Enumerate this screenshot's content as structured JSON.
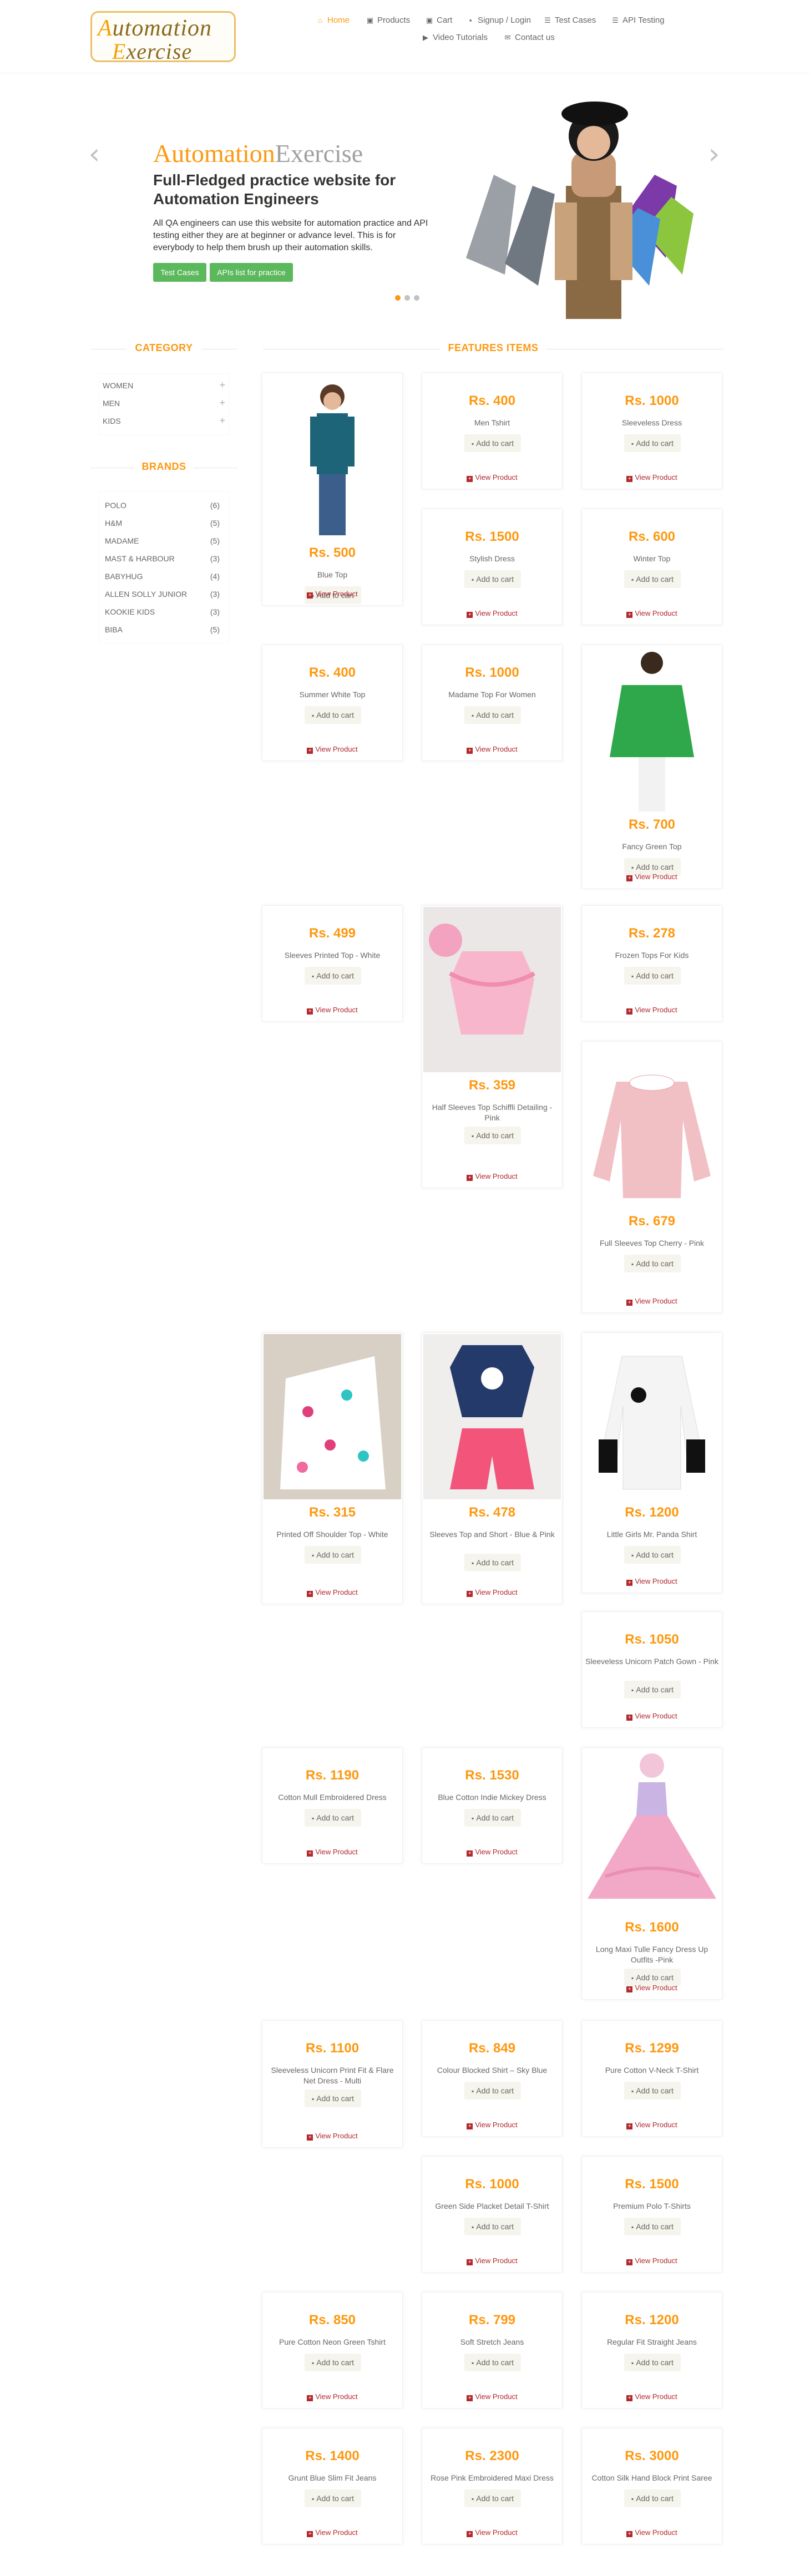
{
  "logo": {
    "line1": "Automation",
    "line2": "Exercise"
  },
  "nav": [
    {
      "label": "Home",
      "icon": "home-icon",
      "glyph": "⌂"
    },
    {
      "label": "Products",
      "icon": "products-icon",
      "glyph": "▣"
    },
    {
      "label": "Cart",
      "icon": "cart-icon",
      "glyph": "🛒"
    },
    {
      "label": "Signup / Login",
      "icon": "lock-icon",
      "glyph": "🔒"
    },
    {
      "label": "Test Cases",
      "icon": "list-icon",
      "glyph": "☰"
    },
    {
      "label": "API Testing",
      "icon": "list-icon",
      "glyph": "☰"
    },
    {
      "label": "Video Tutorials",
      "icon": "youtube-icon",
      "glyph": "▶"
    },
    {
      "label": "Contact us",
      "icon": "envelope-icon",
      "glyph": "✉"
    }
  ],
  "slider": {
    "title_a": "Automation",
    "title_b": "Exercise",
    "subtitle": "Full-Fledged practice website for Automation Engineers",
    "description": "All QA engineers can use this website for automation practice and API testing either they are at beginner or advance level. This is for everybody to help them brush up their automation skills.",
    "btn_test_cases": "Test Cases",
    "btn_apis": "APIs list for practice",
    "prev": "‹",
    "next": "›"
  },
  "category": {
    "title": "CATEGORY",
    "items": [
      {
        "label": "WOMEN",
        "plus": "+"
      },
      {
        "label": "MEN",
        "plus": "+"
      },
      {
        "label": "KIDS",
        "plus": "+"
      }
    ]
  },
  "brands": {
    "title": "BRANDS",
    "items": [
      {
        "label": "POLO",
        "count": "(6)"
      },
      {
        "label": "H&M",
        "count": "(5)"
      },
      {
        "label": "MADAME",
        "count": "(5)"
      },
      {
        "label": "MAST & HARBOUR",
        "count": "(3)"
      },
      {
        "label": "BABYHUG",
        "count": "(4)"
      },
      {
        "label": "ALLEN SOLLY JUNIOR",
        "count": "(3)"
      },
      {
        "label": "KOOKIE KIDS",
        "count": "(3)"
      },
      {
        "label": "BIBA",
        "count": "(5)"
      }
    ]
  },
  "features_title": "FEATURES ITEMS",
  "add_to_cart": "Add to cart",
  "view_product": "View Product",
  "products": [
    {
      "price": "Rs. 500",
      "name": "Blue Top"
    },
    {
      "price": "Rs. 400",
      "name": "Men Tshirt"
    },
    {
      "price": "Rs. 1000",
      "name": "Sleeveless Dress"
    },
    {
      "price": "Rs. 1500",
      "name": "Stylish Dress"
    },
    {
      "price": "Rs. 600",
      "name": "Winter Top"
    },
    {
      "price": "Rs. 400",
      "name": "Summer White Top"
    },
    {
      "price": "Rs. 1000",
      "name": "Madame Top For Women"
    },
    {
      "price": "Rs. 700",
      "name": "Fancy Green Top"
    },
    {
      "price": "Rs. 499",
      "name": "Sleeves Printed Top - White"
    },
    {
      "price": "Rs. 359",
      "name": "Half Sleeves Top Schiffli Detailing - Pink"
    },
    {
      "price": "Rs. 278",
      "name": "Frozen Tops For Kids"
    },
    {
      "price": "Rs. 679",
      "name": "Full Sleeves Top Cherry - Pink"
    },
    {
      "price": "Rs. 315",
      "name": "Printed Off Shoulder Top - White"
    },
    {
      "price": "Rs. 478",
      "name": "Sleeves Top and Short - Blue & Pink"
    },
    {
      "price": "Rs. 1200",
      "name": "Little Girls Mr. Panda Shirt"
    },
    {
      "price": "Rs. 1050",
      "name": "Sleeveless Unicorn Patch Gown - Pink"
    },
    {
      "price": "Rs. 1190",
      "name": "Cotton Mull Embroidered Dress"
    },
    {
      "price": "Rs. 1530",
      "name": "Blue Cotton Indie Mickey Dress"
    },
    {
      "price": "Rs. 1600",
      "name": "Long Maxi Tulle Fancy Dress Up Outfits -Pink"
    },
    {
      "price": "Rs. 1100",
      "name": "Sleeveless Unicorn Print Fit & Flare Net Dress - Multi"
    },
    {
      "price": "Rs. 849",
      "name": "Colour Blocked Shirt – Sky Blue"
    },
    {
      "price": "Rs. 1299",
      "name": "Pure Cotton V-Neck T-Shirt"
    },
    {
      "price": "Rs. 1000",
      "name": "Green Side Placket Detail T-Shirt"
    },
    {
      "price": "Rs. 1500",
      "name": "Premium Polo T-Shirts"
    },
    {
      "price": "Rs. 850",
      "name": "Pure Cotton Neon Green Tshirt"
    },
    {
      "price": "Rs. 799",
      "name": "Soft Stretch Jeans"
    },
    {
      "price": "Rs. 1200",
      "name": "Regular Fit Straight Jeans"
    },
    {
      "price": "Rs. 1400",
      "name": "Grunt Blue Slim Fit Jeans"
    },
    {
      "price": "Rs. 2300",
      "name": "Rose Pink Embroidered Maxi Dress"
    },
    {
      "price": "Rs. 3000",
      "name": "Cotton Silk Hand Block Print Saree"
    }
  ],
  "colors": {
    "accent": "#FE980F",
    "green": "#5CB85C",
    "view_red": "#B3282D",
    "text": "#696763"
  }
}
